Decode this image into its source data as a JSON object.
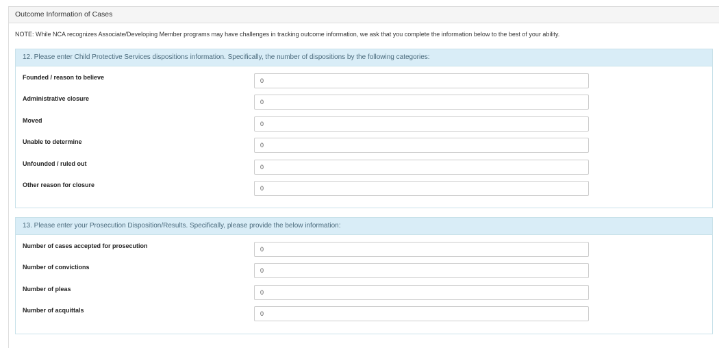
{
  "panel": {
    "title": "Outcome Information of Cases",
    "note": "NOTE: While NCA recognizes Associate/Developing Member programs may have challenges in tracking outcome information, we ask that you complete the information below to the best of your ability."
  },
  "section12": {
    "heading": "12. Please enter Child Protective Services dispositions information. Specifically, the number of dispositions by the following categories:",
    "fields": [
      {
        "label": "Founded / reason to believe",
        "value": "0"
      },
      {
        "label": "Administrative closure",
        "value": "0"
      },
      {
        "label": "Moved",
        "value": "0"
      },
      {
        "label": "Unable to determine",
        "value": "0"
      },
      {
        "label": "Unfounded / ruled out",
        "value": "0"
      },
      {
        "label": "Other reason for closure",
        "value": "0"
      }
    ]
  },
  "section13": {
    "heading": "13. Please enter your Prosecution Disposition/Results. Specifically, please provide the below information:",
    "fields": [
      {
        "label": "Number of cases accepted for prosecution",
        "value": "0"
      },
      {
        "label": "Number of convictions",
        "value": "0"
      },
      {
        "label": "Number of pleas",
        "value": "0"
      },
      {
        "label": "Number of acquittals",
        "value": "0"
      }
    ]
  }
}
